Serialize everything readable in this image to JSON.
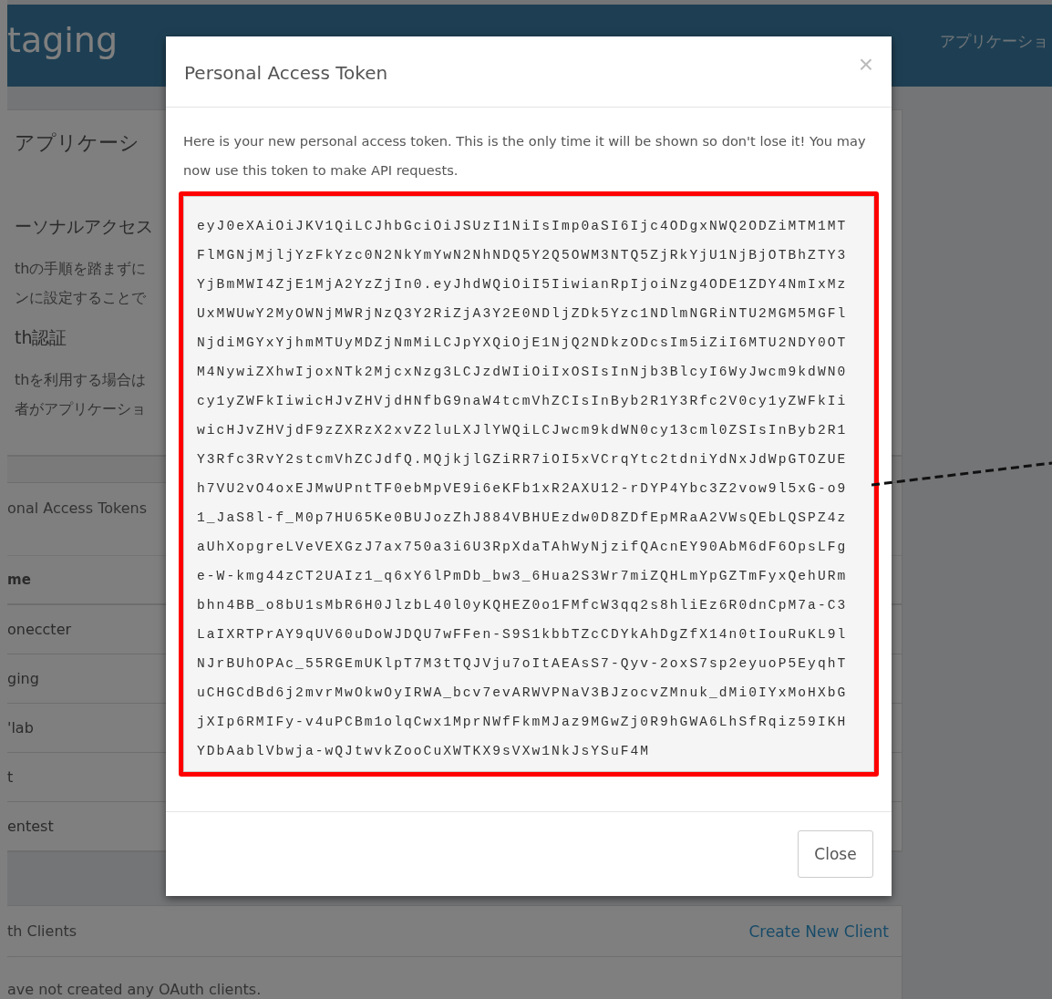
{
  "header": {
    "brand": "taging",
    "nav": [
      "アプリケーショ"
    ]
  },
  "page": {
    "heading": "アプリケーシ",
    "sections": [
      {
        "title": "ーソナルアクセス",
        "lines": [
          "thの手順を踏まずに",
          "ンに設定することで"
        ]
      },
      {
        "title": "th認証",
        "lines": [
          "thを利用する場合は",
          "者がアプリケーショ"
        ]
      }
    ],
    "tokens_panel": {
      "title": "onal Access Tokens",
      "column": "me",
      "rows": [
        "oneccter",
        "ging",
        "'lab",
        "t",
        "entest"
      ]
    },
    "clients_panel": {
      "title": "th Clients",
      "link": "Create New Client",
      "empty": "ave not created any OAuth clients."
    }
  },
  "modal": {
    "title": "Personal Access Token",
    "close_icon": "×",
    "message": "Here is your new personal access token. This is the only time it will be shown so don't lose it! You may now use this token to make API requests.",
    "token_lines": [
      "eyJ0eXAiOiJKV1QiLCJhbGciOiJSUzI1NiIsImp0aSI6Ijc4ODgxNWQ2ODZiMTM1MT",
      "FlMGNjMjljYzFkYzc0N2NkYmYwN2NhNDQ5Y2Q5OWM3NTQ5ZjRkYjU1NjBjOTBhZTY3",
      "YjBmMWI4ZjE1MjA2YzZjIn0.eyJhdWQiOiI5IiwianRpIjoiNzg4ODE1ZDY4NmIxMz",
      "UxMWUwY2MyOWNjMWRjNzQ3Y2RiZjA3Y2E0NDljZDk5Yzc1NDlmNGRiNTU2MGM5MGFl",
      "NjdiMGYxYjhmMTUyMDZjNmMiLCJpYXQiOjE1NjQ2NDkzODcsIm5iZiI6MTU2NDY0OT",
      "M4NywiZXhwIjoxNTk2MjcxNzg3LCJzdWIiOiIxOSIsInNjb3BlcyI6WyJwcm9kdWN0",
      "cy1yZWFkIiwicHJvZHVjdHNfbG9naW4tcmVhZCIsInByb2R1Y3Rfc2V0cy1yZWFkIi",
      "wicHJvZHVjdF9zZXRzX2xvZ2luLXJlYWQiLCJwcm9kdWN0cy13cml0ZSIsInByb2R1",
      "Y3Rfc3RvY2stcmVhZCJdfQ.MQjkjlGZiRR7iOI5xVCrqYtc2tdniYdNxJdWpGTOZUE",
      "h7VU2vO4oxEJMwUPntTF0ebMpVE9i6eKFb1xR2AXU12-rDYP4Ybc3Z2vow9l5xG-o9",
      "1_JaS8l-f_M0p7HU65Ke0BUJozZhJ884VBHUEzdw0D8ZDfEpMRaA2VWsQEbLQSPZ4z",
      "aUhXopgreLVeVEXGzJ7ax750a3i6U3RpXdaTAhWyNjzifQAcnEY90AbM6dF6OpsLFg",
      "e-W-kmg44zCT2UAIz1_q6xY6lPmDb_bw3_6Hua2S3Wr7miZQHLmYpGZTmFyxQehURm",
      "bhn4BB_o8bU1sMbR6H0JlzbL40l0yKQHEZ0o1FMfcW3qq2s8hliEz6R0dnCpM7a-C3",
      "LaIXRTPrAY9qUV60uDoWJDQU7wFFen-S9S1kbbTZcCDYkAhDgZfX14n0tIouRuKL9l",
      "NJrBUhOPAc_55RGEmUKlpT7M3tTQJVju7oItAEAsS7-Qyv-2oxS7sp2eyuoP5EyqhT",
      "uCHGCdBd6j2mvrMwOkwOyIRWA_bcv7evARWVPNaV3BJzocvZMnuk_dMi0IYxMoHXbG",
      "jXIp6RMIFy-v4uPCBm1olqCwx1MprNWfFkmMJaz9MGwZj0R9hGWA6LhSfRqiz59IKH",
      "YDbAablVbwja-wQJtwvkZooCuXWTKX9sVXw1NkJsYSuF4M"
    ],
    "button": "Close"
  }
}
